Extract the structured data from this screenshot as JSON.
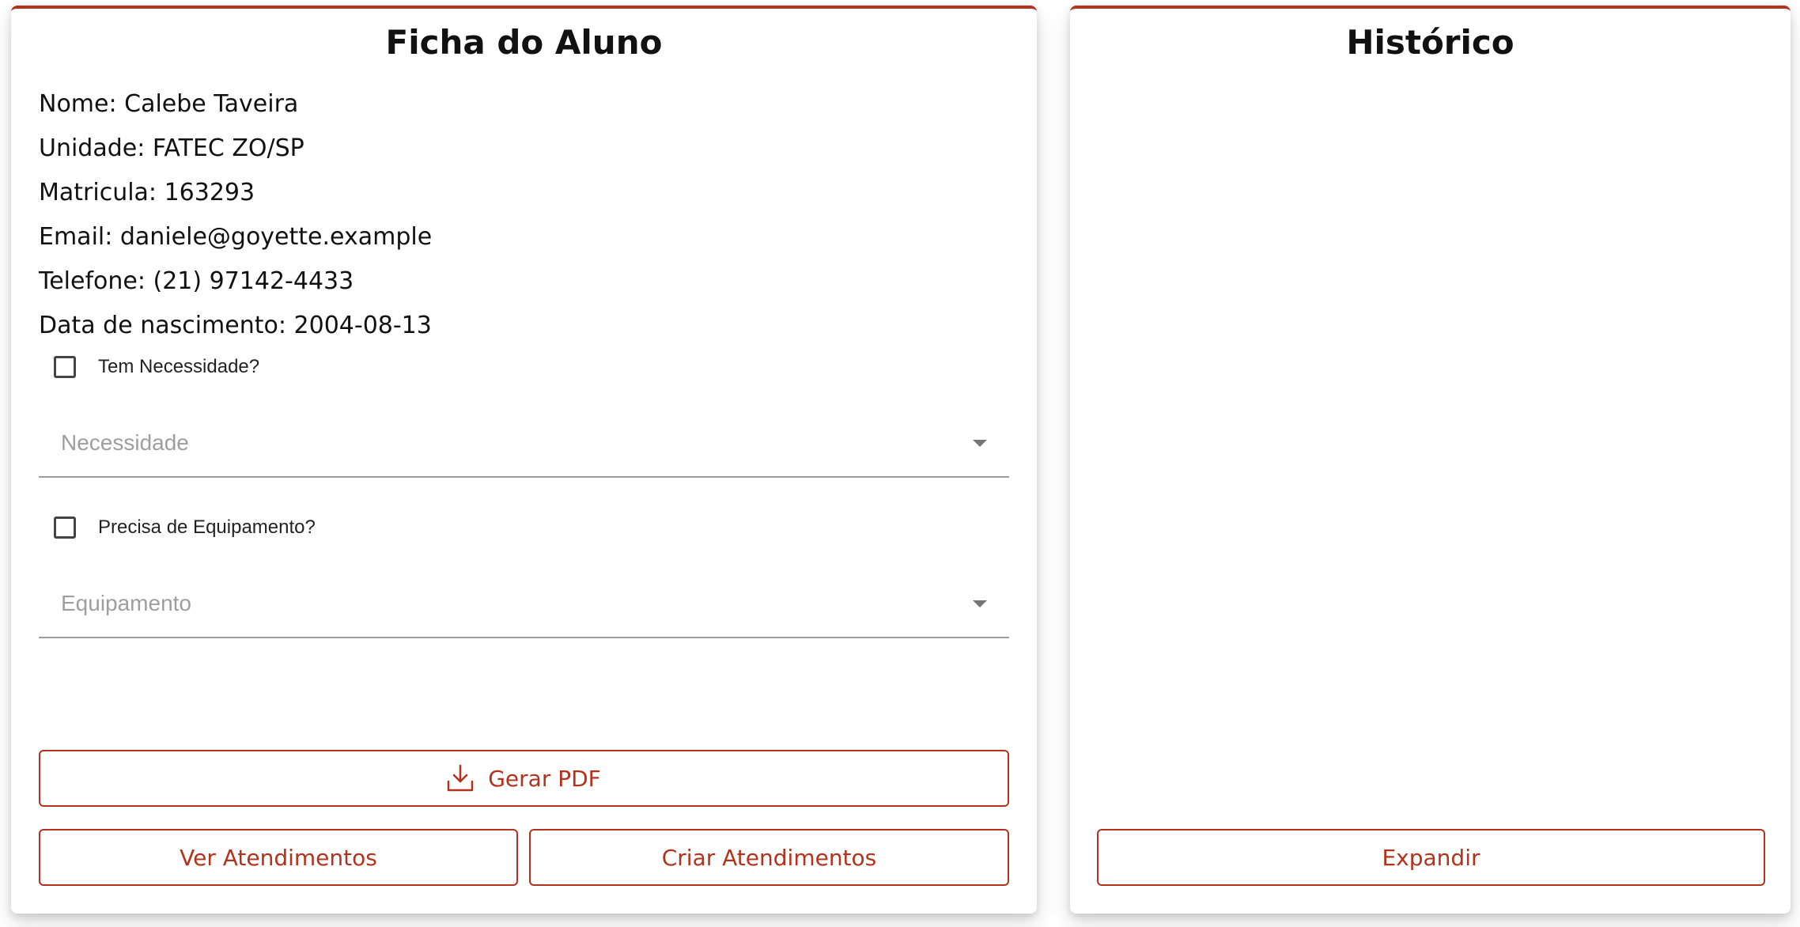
{
  "ficha": {
    "title": "Ficha do Aluno",
    "nome": "Nome: Calebe Taveira",
    "unidade": "Unidade: FATEC ZO/SP",
    "matricula": "Matricula: 163293",
    "email": "Email: daniele@goyette.example",
    "telefone": "Telefone: (21) 97142-4433",
    "nascimento": "Data de nascimento: 2004-08-13",
    "necessidade_checkbox_label": "Tem Necessidade?",
    "necessidade_placeholder": "Necessidade",
    "equipamento_checkbox_label": "Precisa de Equipamento?",
    "equipamento_placeholder": "Equipamento",
    "gerar_pdf_label": "Gerar PDF",
    "ver_atendimentos_label": "Ver Atendimentos",
    "criar_atendimentos_label": "Criar Atendimentos"
  },
  "historico": {
    "title": "Histórico",
    "expandir_label": "Expandir"
  },
  "icons": {
    "download": "download-icon",
    "dropdown": "chevron-down-icon"
  },
  "colors": {
    "accent": "#b3321d",
    "text": "#111111",
    "placeholder": "#9e9e9e"
  }
}
